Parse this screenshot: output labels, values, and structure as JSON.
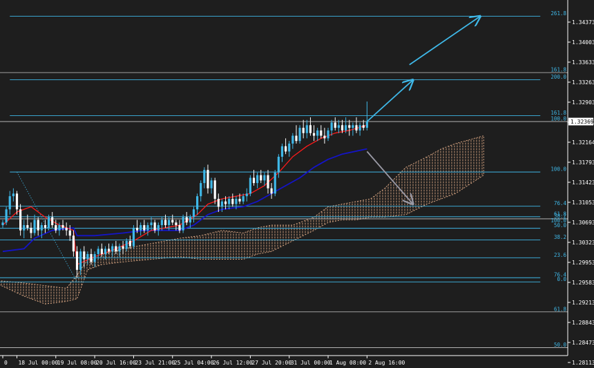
{
  "colors": {
    "background": "#1e1e1e",
    "axis": "#ffffff",
    "fib": "#3fb8e8",
    "bull_candle": "#3fb8e8",
    "bear_candle": "#ffffff",
    "tenkan": "#ff1a1a",
    "kijun": "#1414c8",
    "cloud": "#e8b08a",
    "arrow_up": "#3fb8e8",
    "arrow_down": "#9a9aa6",
    "current_price_bg": "#ffffff",
    "current_price_text": "#000000"
  },
  "chart_data": {
    "type": "candlestick",
    "ylim": [
      1.2792,
      1.3468
    ],
    "y_ticks": [
      "1.34373",
      "1.34003",
      "1.33633",
      "1.33263",
      "1.32903",
      "1.32533",
      "1.32164",
      "1.31793",
      "1.31423",
      "1.31053",
      "1.30693",
      "1.30323",
      "1.29953",
      "1.29583",
      "1.29213",
      "1.28843",
      "1.28473",
      "1.28113"
    ],
    "x_ticks": [
      {
        "label": "0",
        "bar": 0
      },
      {
        "label": "18 Jul 00:00",
        "bar": 4
      },
      {
        "label": "19 Jul 08:00",
        "bar": 15
      },
      {
        "label": "20 Jul 16:00",
        "bar": 26
      },
      {
        "label": "23 Jul 21:00",
        "bar": 37
      },
      {
        "label": "25 Jul 04:00",
        "bar": 48
      },
      {
        "label": "26 Jul 12:00",
        "bar": 59
      },
      {
        "label": "27 Jul 20:00",
        "bar": 70
      },
      {
        "label": "31 Jul 00:00",
        "bar": 81
      },
      {
        "label": "1 Aug 08:00",
        "bar": 92
      },
      {
        "label": "2 Aug 16:00",
        "bar": 103
      }
    ],
    "current_price": "1.32369",
    "candles": [
      [
        1.304,
        1.305,
        1.3035,
        1.3045
      ],
      [
        1.3045,
        1.3075,
        1.304,
        1.307
      ],
      [
        1.307,
        1.3105,
        1.306,
        1.3095
      ],
      [
        1.3095,
        1.311,
        1.3085,
        1.31
      ],
      [
        1.31,
        1.3105,
        1.306,
        1.307
      ],
      [
        1.307,
        1.308,
        1.302,
        1.303
      ],
      [
        1.303,
        1.305,
        1.3015,
        1.304
      ],
      [
        1.304,
        1.306,
        1.303,
        1.3035
      ],
      [
        1.3035,
        1.3045,
        1.3015,
        1.3025
      ],
      [
        1.3025,
        1.306,
        1.302,
        1.305
      ],
      [
        1.305,
        1.3055,
        1.302,
        1.303
      ],
      [
        1.303,
        1.3045,
        1.3015,
        1.304
      ],
      [
        1.304,
        1.305,
        1.3025,
        1.3035
      ],
      [
        1.3035,
        1.306,
        1.303,
        1.3055
      ],
      [
        1.3055,
        1.3065,
        1.3035,
        1.304
      ],
      [
        1.304,
        1.305,
        1.3025,
        1.303
      ],
      [
        1.303,
        1.3045,
        1.302,
        1.304
      ],
      [
        1.304,
        1.305,
        1.303,
        1.3035
      ],
      [
        1.3035,
        1.3045,
        1.302,
        1.303
      ],
      [
        1.303,
        1.304,
        1.301,
        1.302
      ],
      [
        1.302,
        1.303,
        1.298,
        1.299
      ],
      [
        1.299,
        1.3,
        1.294,
        1.2955
      ],
      [
        1.2955,
        1.2995,
        1.2945,
        1.299
      ],
      [
        1.299,
        1.3,
        1.296,
        1.2975
      ],
      [
        1.2975,
        1.299,
        1.2965,
        1.2985
      ],
      [
        1.2985,
        1.2995,
        1.2965,
        1.297
      ],
      [
        1.297,
        1.299,
        1.296,
        1.2985
      ],
      [
        1.2985,
        1.3,
        1.2975,
        1.2995
      ],
      [
        1.2995,
        1.3005,
        1.298,
        1.2985
      ],
      [
        1.2985,
        1.3,
        1.2975,
        1.2995
      ],
      [
        1.2995,
        1.3005,
        1.2985,
        1.299
      ],
      [
        1.299,
        1.3005,
        1.298,
        1.3
      ],
      [
        1.3,
        1.301,
        1.2985,
        1.299
      ],
      [
        1.299,
        1.3005,
        1.298,
        1.3
      ],
      [
        1.3,
        1.301,
        1.2985,
        1.2995
      ],
      [
        1.2995,
        1.3015,
        1.299,
        1.301
      ],
      [
        1.301,
        1.302,
        1.2995,
        1.3
      ],
      [
        1.3,
        1.304,
        1.2995,
        1.3035
      ],
      [
        1.3035,
        1.305,
        1.3025,
        1.303
      ],
      [
        1.303,
        1.3045,
        1.302,
        1.304
      ],
      [
        1.304,
        1.305,
        1.3025,
        1.303
      ],
      [
        1.303,
        1.3045,
        1.302,
        1.304
      ],
      [
        1.304,
        1.3055,
        1.303,
        1.3045
      ],
      [
        1.3045,
        1.305,
        1.3025,
        1.303
      ],
      [
        1.303,
        1.3045,
        1.302,
        1.304
      ],
      [
        1.304,
        1.3055,
        1.303,
        1.305
      ],
      [
        1.305,
        1.306,
        1.3035,
        1.304
      ],
      [
        1.304,
        1.3055,
        1.303,
        1.305
      ],
      [
        1.305,
        1.306,
        1.304,
        1.3045
      ],
      [
        1.3045,
        1.305,
        1.303,
        1.304
      ],
      [
        1.304,
        1.305,
        1.3025,
        1.303
      ],
      [
        1.303,
        1.306,
        1.3025,
        1.3055
      ],
      [
        1.3055,
        1.3065,
        1.304,
        1.3045
      ],
      [
        1.3045,
        1.306,
        1.3035,
        1.3055
      ],
      [
        1.3055,
        1.3075,
        1.3045,
        1.307
      ],
      [
        1.307,
        1.31,
        1.306,
        1.3095
      ],
      [
        1.3095,
        1.3125,
        1.3085,
        1.312
      ],
      [
        1.312,
        1.315,
        1.311,
        1.3145
      ],
      [
        1.3145,
        1.3155,
        1.31,
        1.311
      ],
      [
        1.311,
        1.313,
        1.31,
        1.3125
      ],
      [
        1.3125,
        1.313,
        1.308,
        1.309
      ],
      [
        1.309,
        1.31,
        1.3065,
        1.3075
      ],
      [
        1.3075,
        1.309,
        1.3065,
        1.3085
      ],
      [
        1.3085,
        1.3095,
        1.307,
        1.308
      ],
      [
        1.308,
        1.3095,
        1.307,
        1.309
      ],
      [
        1.309,
        1.31,
        1.3075,
        1.308
      ],
      [
        1.308,
        1.3095,
        1.307,
        1.309
      ],
      [
        1.309,
        1.31,
        1.308,
        1.3085
      ],
      [
        1.3085,
        1.31,
        1.308,
        1.3095
      ],
      [
        1.3095,
        1.311,
        1.3085,
        1.31
      ],
      [
        1.31,
        1.3135,
        1.3095,
        1.313
      ],
      [
        1.313,
        1.3145,
        1.3115,
        1.312
      ],
      [
        1.312,
        1.314,
        1.311,
        1.3135
      ],
      [
        1.3135,
        1.3145,
        1.312,
        1.3125
      ],
      [
        1.3125,
        1.314,
        1.3115,
        1.3135
      ],
      [
        1.3135,
        1.3145,
        1.31,
        1.311
      ],
      [
        1.311,
        1.312,
        1.309,
        1.31
      ],
      [
        1.31,
        1.3145,
        1.3095,
        1.314
      ],
      [
        1.314,
        1.3175,
        1.313,
        1.317
      ],
      [
        1.317,
        1.3195,
        1.316,
        1.319
      ],
      [
        1.319,
        1.3205,
        1.3175,
        1.318
      ],
      [
        1.318,
        1.32,
        1.317,
        1.3195
      ],
      [
        1.3195,
        1.3215,
        1.3185,
        1.321
      ],
      [
        1.321,
        1.323,
        1.3195,
        1.32
      ],
      [
        1.32,
        1.323,
        1.3195,
        1.3225
      ],
      [
        1.3225,
        1.324,
        1.3205,
        1.3215
      ],
      [
        1.3215,
        1.324,
        1.3205,
        1.323
      ],
      [
        1.323,
        1.3245,
        1.321,
        1.3215
      ],
      [
        1.3215,
        1.323,
        1.32,
        1.321
      ],
      [
        1.321,
        1.3225,
        1.32,
        1.322
      ],
      [
        1.322,
        1.323,
        1.3205,
        1.321
      ],
      [
        1.321,
        1.3225,
        1.3195,
        1.3205
      ],
      [
        1.3205,
        1.3225,
        1.32,
        1.322
      ],
      [
        1.322,
        1.324,
        1.321,
        1.3235
      ],
      [
        1.3235,
        1.3245,
        1.322,
        1.3225
      ],
      [
        1.3225,
        1.324,
        1.3215,
        1.323
      ],
      [
        1.323,
        1.324,
        1.3215,
        1.322
      ],
      [
        1.322,
        1.3245,
        1.3215,
        1.323
      ],
      [
        1.323,
        1.324,
        1.321,
        1.3225
      ],
      [
        1.3225,
        1.3235,
        1.321,
        1.323
      ],
      [
        1.323,
        1.3245,
        1.3215,
        1.322
      ],
      [
        1.322,
        1.3235,
        1.321,
        1.323
      ],
      [
        1.323,
        1.324,
        1.322,
        1.3225
      ],
      [
        1.3225,
        1.3275,
        1.322,
        1.3237
      ]
    ],
    "tenkan_sen": [
      [
        0,
        1.304
      ],
      [
        4,
        1.3065
      ],
      [
        8,
        1.3075
      ],
      [
        12,
        1.3055
      ],
      [
        16,
        1.304
      ],
      [
        20,
        1.303
      ],
      [
        21,
        1.2965
      ],
      [
        26,
        1.298
      ],
      [
        32,
        1.2995
      ],
      [
        37,
        1.301
      ],
      [
        42,
        1.303
      ],
      [
        50,
        1.304
      ],
      [
        55,
        1.306
      ],
      [
        58,
        1.308
      ],
      [
        62,
        1.309
      ],
      [
        66,
        1.3095
      ],
      [
        70,
        1.31
      ],
      [
        74,
        1.3115
      ],
      [
        78,
        1.314
      ],
      [
        82,
        1.317
      ],
      [
        86,
        1.319
      ],
      [
        90,
        1.3205
      ],
      [
        94,
        1.3215
      ],
      [
        98,
        1.322
      ],
      [
        103,
        1.323
      ]
    ],
    "kijun_sen": [
      [
        0,
        1.299
      ],
      [
        6,
        1.2995
      ],
      [
        9,
        1.3015
      ],
      [
        14,
        1.303
      ],
      [
        20,
        1.3035
      ],
      [
        21,
        1.302
      ],
      [
        26,
        1.302
      ],
      [
        34,
        1.3025
      ],
      [
        40,
        1.303
      ],
      [
        50,
        1.303
      ],
      [
        54,
        1.304
      ],
      [
        58,
        1.306
      ],
      [
        62,
        1.307
      ],
      [
        68,
        1.3075
      ],
      [
        72,
        1.3085
      ],
      [
        76,
        1.31
      ],
      [
        80,
        1.3115
      ],
      [
        84,
        1.313
      ],
      [
        88,
        1.315
      ],
      [
        92,
        1.3165
      ],
      [
        96,
        1.3175
      ],
      [
        103,
        1.3185
      ]
    ],
    "cloud_top": [
      [
        -2,
        1.2935
      ],
      [
        6,
        1.293
      ],
      [
        12,
        1.2925
      ],
      [
        18,
        1.292
      ],
      [
        21,
        1.2945
      ],
      [
        24,
        1.2975
      ],
      [
        28,
        1.2985
      ],
      [
        34,
        1.2995
      ],
      [
        42,
        1.3005
      ],
      [
        50,
        1.3015
      ],
      [
        56,
        1.302
      ],
      [
        62,
        1.303
      ],
      [
        68,
        1.3025
      ],
      [
        72,
        1.3035
      ],
      [
        76,
        1.304
      ],
      [
        82,
        1.304
      ],
      [
        88,
        1.3055
      ],
      [
        92,
        1.3075
      ],
      [
        96,
        1.308
      ],
      [
        100,
        1.3085
      ],
      [
        104,
        1.309
      ],
      [
        108,
        1.311
      ],
      [
        114,
        1.315
      ],
      [
        120,
        1.317
      ],
      [
        124,
        1.3185
      ],
      [
        128,
        1.3195
      ],
      [
        136,
        1.321
      ]
    ],
    "cloud_bottom": [
      [
        -2,
        1.293
      ],
      [
        6,
        1.2905
      ],
      [
        12,
        1.289
      ],
      [
        18,
        1.2895
      ],
      [
        21,
        1.29
      ],
      [
        24,
        1.2955
      ],
      [
        28,
        1.2965
      ],
      [
        34,
        1.297
      ],
      [
        42,
        1.2975
      ],
      [
        50,
        1.298
      ],
      [
        56,
        1.2975
      ],
      [
        62,
        1.2975
      ],
      [
        68,
        1.2975
      ],
      [
        72,
        1.2985
      ],
      [
        76,
        1.299
      ],
      [
        82,
        1.301
      ],
      [
        88,
        1.303
      ],
      [
        92,
        1.3045
      ],
      [
        96,
        1.305
      ],
      [
        100,
        1.305
      ],
      [
        104,
        1.3055
      ],
      [
        108,
        1.3055
      ],
      [
        114,
        1.306
      ],
      [
        120,
        1.308
      ],
      [
        124,
        1.309
      ],
      [
        128,
        1.31
      ],
      [
        136,
        1.3135
      ]
    ],
    "fib_levels": [
      {
        "price": 1.34373,
        "label": "261.8",
        "x_start_bar": 2,
        "x_end_bar": 152
      },
      {
        "price": 1.33163,
        "label": "200.0",
        "x_start_bar": 2,
        "x_end_bar": 152
      },
      {
        "price": 1.3248,
        "label": "161.8",
        "x_start_bar": 2,
        "x_end_bar": 152
      },
      {
        "price": 1.3141,
        "label": "100.0",
        "x_start_bar": 2,
        "x_end_bar": 152
      },
      {
        "price": 1.3076,
        "label": "76.4",
        "x_start_bar": -5,
        "x_end_bar": 152
      },
      {
        "price": 1.3056,
        "label": "61.8",
        "x_start_bar": -5,
        "x_end_bar": 152
      },
      {
        "price": 1.3034,
        "label": "50.0",
        "x_start_bar": -5,
        "x_end_bar": 152
      },
      {
        "price": 1.3012,
        "label": "38.2",
        "x_start_bar": -5,
        "x_end_bar": 152
      },
      {
        "price": 1.2978,
        "label": "23.6",
        "x_start_bar": -5,
        "x_end_bar": 152
      },
      {
        "price": 1.294,
        "label": "76.4",
        "x_start_bar": -5,
        "x_end_bar": 152
      },
      {
        "price": 1.2932,
        "label": "0.0",
        "x_start_bar": -5,
        "x_end_bar": 152
      }
    ],
    "upper_fib_levels": [
      {
        "price": 1.333,
        "label": "161.8",
        "x_start_bar": -5,
        "x_end_bar": 152
      },
      {
        "price": 1.32369,
        "label": "100.0",
        "x_start_bar": -5,
        "x_end_bar": 152
      },
      {
        "price": 1.3052,
        "label": "38.2",
        "x_start_bar": -5,
        "x_end_bar": 152
      },
      {
        "price": 1.2875,
        "label": "61.8",
        "x_start_bar": -5,
        "x_end_bar": 152
      },
      {
        "price": 1.2807,
        "label": "50.0",
        "x_start_bar": -5,
        "x_end_bar": 152
      }
    ],
    "extra_labels": [
      {
        "price": 1.3056,
        "label": "100.0"
      }
    ],
    "fib_diagonal": [
      [
        4,
        1.3141
      ],
      [
        21,
        1.2932
      ]
    ],
    "arrows": [
      {
        "role": "up",
        "points": [
          [
            103,
            1.3237
          ],
          [
            116,
            1.3316
          ]
        ]
      },
      {
        "role": "up",
        "points": [
          [
            115,
            1.3345
          ],
          [
            135,
            1.3437
          ]
        ]
      },
      {
        "role": "down",
        "points": [
          [
            103,
            1.318
          ],
          [
            116,
            1.308
          ]
        ]
      }
    ]
  }
}
